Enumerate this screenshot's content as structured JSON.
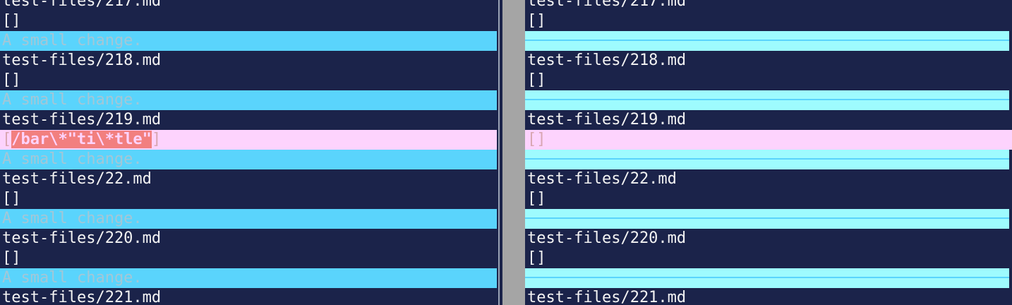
{
  "left": {
    "lines": [
      {
        "type": "plain",
        "text": "test-files/217.md"
      },
      {
        "type": "plain",
        "text": "[]"
      },
      {
        "type": "del",
        "text": "A small change."
      },
      {
        "type": "plain",
        "text": "test-files/218.md"
      },
      {
        "type": "plain",
        "text": "[]"
      },
      {
        "type": "del",
        "text": "A small change."
      },
      {
        "type": "plain",
        "text": "test-files/219.md"
      },
      {
        "type": "changed",
        "pre": "[",
        "hl": "/bar\\*\"ti\\*tle\"",
        "post": "]"
      },
      {
        "type": "del",
        "text": "A small change."
      },
      {
        "type": "plain",
        "text": "test-files/22.md"
      },
      {
        "type": "plain",
        "text": "[]"
      },
      {
        "type": "del",
        "text": "A small change."
      },
      {
        "type": "plain",
        "text": "test-files/220.md"
      },
      {
        "type": "plain",
        "text": "[]"
      },
      {
        "type": "del",
        "text": "A small change."
      },
      {
        "type": "plain",
        "text": "test-files/221.md"
      }
    ]
  },
  "right": {
    "lines": [
      {
        "type": "plain",
        "text": "test-files/217.md"
      },
      {
        "type": "plain",
        "text": "[]"
      },
      {
        "type": "filler",
        "text": ""
      },
      {
        "type": "plain",
        "text": "test-files/218.md"
      },
      {
        "type": "plain",
        "text": "[]"
      },
      {
        "type": "filler",
        "text": ""
      },
      {
        "type": "plain",
        "text": "test-files/219.md"
      },
      {
        "type": "changed",
        "text": "[]"
      },
      {
        "type": "filler",
        "text": ""
      },
      {
        "type": "plain",
        "text": "test-files/22.md"
      },
      {
        "type": "plain",
        "text": "[]"
      },
      {
        "type": "filler",
        "text": ""
      },
      {
        "type": "plain",
        "text": "test-files/220.md"
      },
      {
        "type": "plain",
        "text": "[]"
      },
      {
        "type": "filler",
        "text": ""
      },
      {
        "type": "plain",
        "text": "test-files/221.md"
      }
    ]
  },
  "colors": {
    "background": "#1b234a",
    "deleted_line": "#5ad4fc",
    "changed_line": "#fdd3fd",
    "highlight": "#f27f7f",
    "filler_line": "#9efbfe",
    "divider": "#a5a5a5"
  }
}
